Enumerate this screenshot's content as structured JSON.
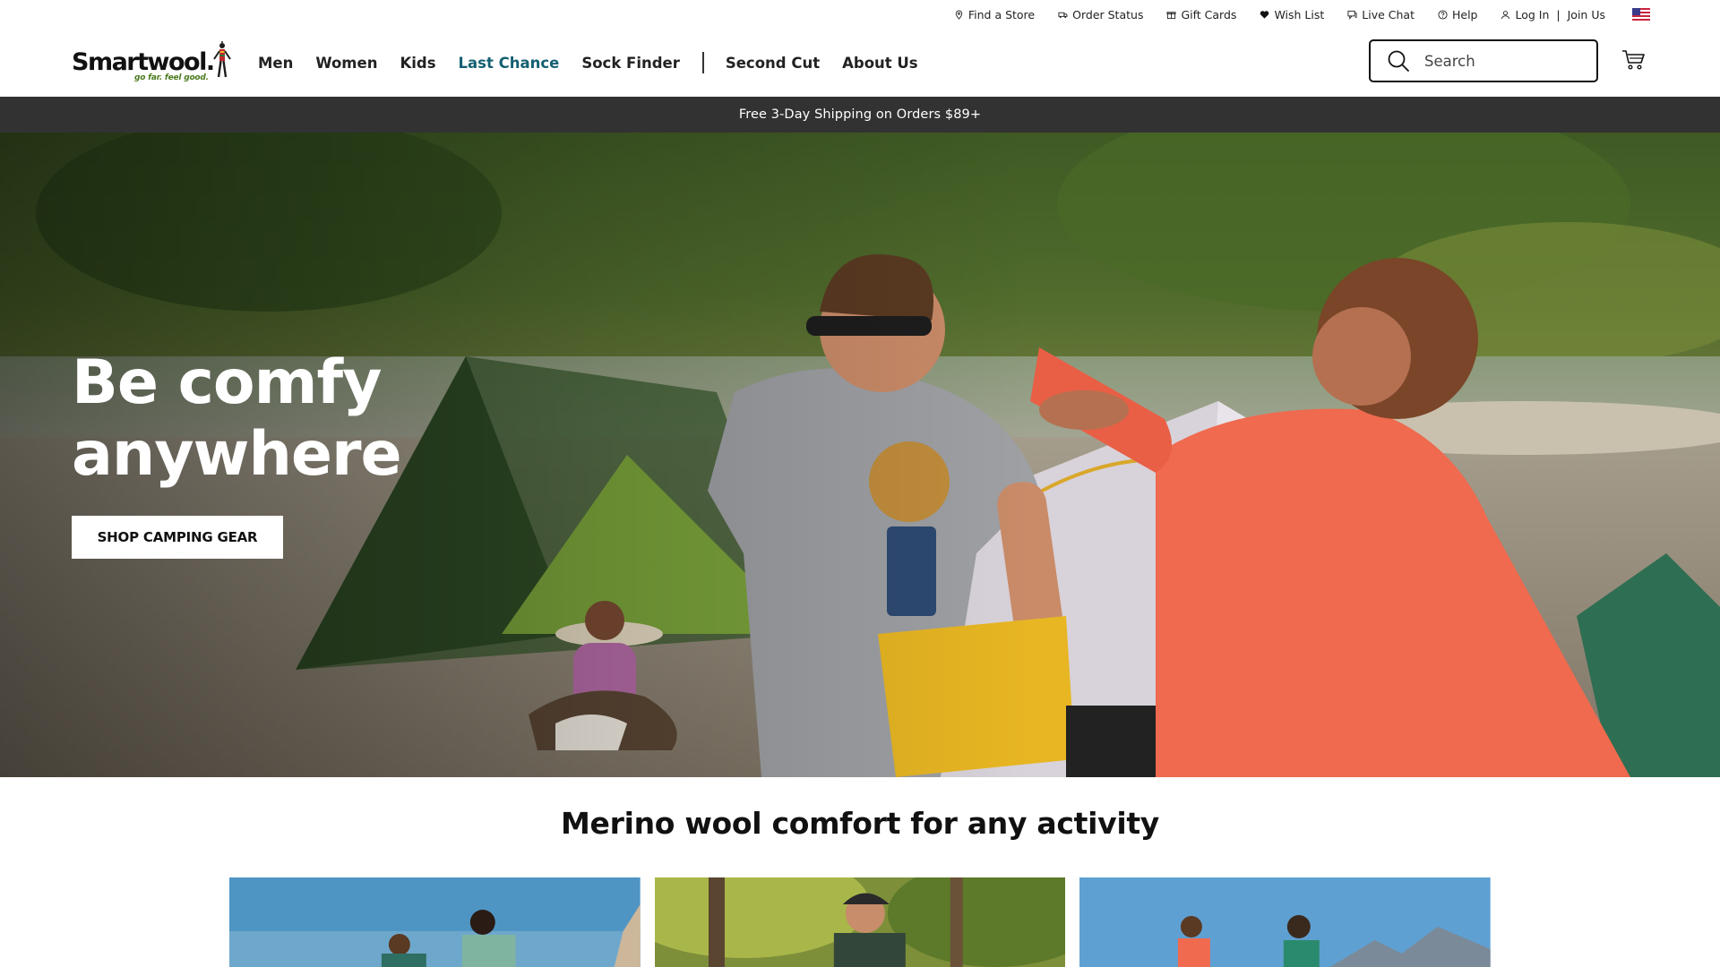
{
  "utility": {
    "find_store": "Find a Store",
    "order_status": "Order Status",
    "gift_cards": "Gift Cards",
    "wish_list": "Wish List",
    "live_chat": "Live Chat",
    "help": "Help",
    "log_in": "Log In",
    "separator": "|",
    "join_us": "Join Us",
    "flag_icon": "us-flag-icon"
  },
  "logo": {
    "word": "Smartwool.",
    "tagline": "go far. feel good."
  },
  "nav": {
    "items": [
      {
        "label": "Men"
      },
      {
        "label": "Women"
      },
      {
        "label": "Kids"
      },
      {
        "label": "Last Chance"
      },
      {
        "label": "Sock Finder"
      },
      {
        "label": "Second Cut"
      },
      {
        "label": "About Us"
      }
    ],
    "accent_color": "#155f72"
  },
  "search": {
    "placeholder": "Search",
    "value": ""
  },
  "promo": {
    "text": "Free 3-Day Shipping on Orders $89+",
    "background": "#323232"
  },
  "hero": {
    "title_line1": "Be comfy",
    "title_line2": "anywhere",
    "cta_label": "SHOP CAMPING GEAR"
  },
  "section": {
    "title": "Merino wool comfort for any activity"
  }
}
